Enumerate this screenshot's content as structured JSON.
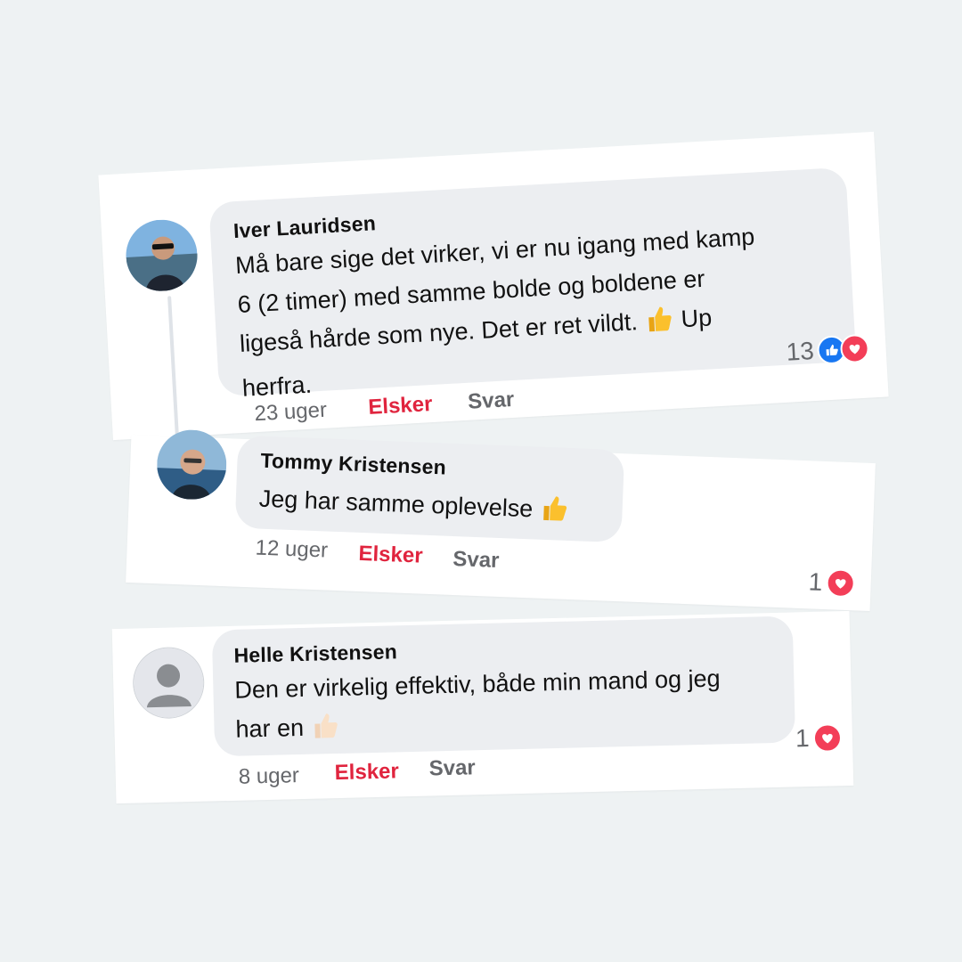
{
  "comments": [
    {
      "author": "Iver Lauridsen",
      "text_lines": [
        "Må bare sige det virker, vi er nu igang med kamp",
        "6 (2 timer) med samme bolde og boldene er",
        "ligeså hårde som nye. Det er ret vildt.",
        "herfra."
      ],
      "inline_tail": "Up",
      "time": "23 uger",
      "love_label": "Elsker",
      "reply_label": "Svar",
      "reaction_count": "13",
      "reaction_icons": [
        "like-icon",
        "heart-icon"
      ]
    },
    {
      "author": "Tommy Kristensen",
      "text": "Jeg har samme oplevelse",
      "time": "12 uger",
      "love_label": "Elsker",
      "reply_label": "Svar",
      "reaction_count": "1",
      "reaction_icons": [
        "heart-icon"
      ]
    },
    {
      "author": "Helle Kristensen",
      "text_lines": [
        "Den er virkelig effektiv, både min mand og jeg",
        "har en"
      ],
      "time": "8 uger",
      "love_label": "Elsker",
      "reply_label": "Svar",
      "reaction_count": "1",
      "reaction_icons": [
        "heart-icon"
      ]
    }
  ],
  "colors": {
    "background": "#eef2f3",
    "bubble": "#eceef1",
    "love_red": "#e0243e",
    "like_blue": "#1877f2",
    "heart_red": "#f33e58",
    "muted": "#65676b"
  }
}
